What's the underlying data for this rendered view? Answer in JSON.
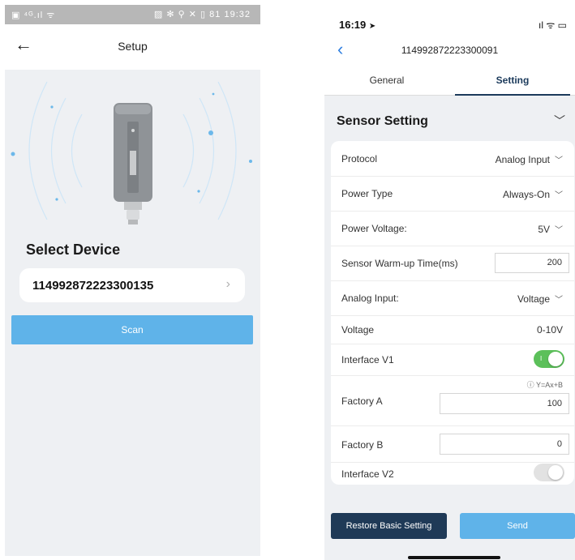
{
  "left": {
    "status_bar": {
      "left_icons": "▣ ⁴ᴳ.ıl ᯤ",
      "right_icons": "▨ ✻ ⚲ ✕ ▯",
      "battery": "81",
      "time": "19:32"
    },
    "header": {
      "title": "Setup"
    },
    "select_label": "Select Device",
    "device_id": "114992872223300135",
    "scan_label": "Scan"
  },
  "right": {
    "status_bar": {
      "time": "16:19",
      "icons": "ıl ᯤ ▭"
    },
    "header": {
      "title": "114992872223300091"
    },
    "tabs": [
      {
        "label": "General",
        "active": false
      },
      {
        "label": "Setting",
        "active": true
      }
    ],
    "section_title": "Sensor Setting",
    "rows": {
      "protocol": {
        "label": "Protocol",
        "value": "Analog Input"
      },
      "power_type": {
        "label": "Power Type",
        "value": "Always-On"
      },
      "power_voltage": {
        "label": "Power Voltage:",
        "value": "5V"
      },
      "warmup": {
        "label": "Sensor Warm-up Time(ms)",
        "value": "200"
      },
      "analog_input": {
        "label": "Analog Input:",
        "value": "Voltage"
      },
      "voltage": {
        "label": "Voltage",
        "value": "0-10V"
      },
      "interface_v1": {
        "label": "Interface V1",
        "on": true
      },
      "factory_a": {
        "label": "Factory A",
        "value": "100",
        "formula": "Y=Ax+B"
      },
      "factory_b": {
        "label": "Factory B",
        "value": "0"
      },
      "interface_v2": {
        "label": "Interface V2",
        "on": false
      }
    },
    "restore_label": "Restore Basic Setting",
    "send_label": "Send"
  },
  "colors": {
    "accent_blue": "#5fb3e9",
    "navy": "#1f3a57",
    "toggle_green": "#5cc05a",
    "back_blue": "#2f7fe0"
  }
}
